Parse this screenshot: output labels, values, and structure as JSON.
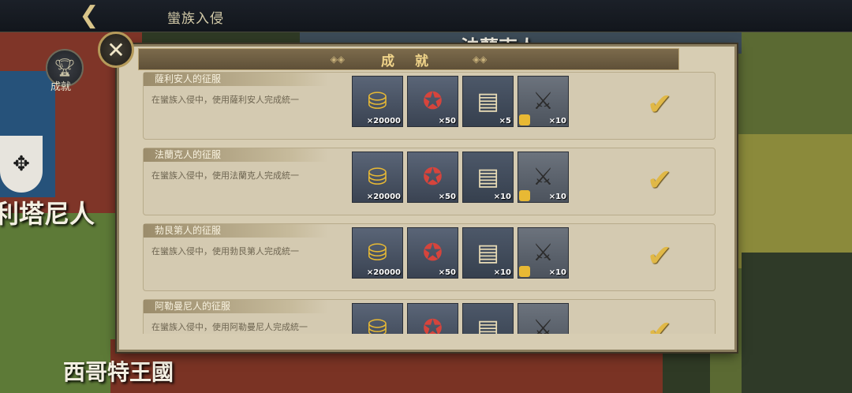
{
  "header": {
    "title": "蠻族入侵",
    "back_icon": "back-arrow-icon"
  },
  "sidebar": {
    "achievements_label": "成就"
  },
  "map": {
    "labels": [
      "利塔尼人",
      "西哥特王國",
      "法蘭克人"
    ]
  },
  "panel": {
    "title": "成 就",
    "close_icon": "close-icon",
    "achievements": [
      {
        "title": "薩利安人的征服",
        "description": "在蠻族入侵中，使用薩利安人完成統一",
        "completed": true,
        "rewards": [
          {
            "icon": "gold-coins-icon",
            "count": "×20000"
          },
          {
            "icon": "medal-icon",
            "count": "×50"
          },
          {
            "icon": "scroll-icon",
            "count": "×5"
          },
          {
            "icon": "unit-fragment-icon",
            "count": "×10"
          }
        ]
      },
      {
        "title": "法蘭克人的征服",
        "description": "在蠻族入侵中，使用法蘭克人完成統一",
        "completed": true,
        "rewards": [
          {
            "icon": "gold-coins-icon",
            "count": "×20000"
          },
          {
            "icon": "medal-icon",
            "count": "×50"
          },
          {
            "icon": "scroll-icon",
            "count": "×10"
          },
          {
            "icon": "unit-fragment-icon",
            "count": "×10"
          }
        ]
      },
      {
        "title": "勃艮第人的征服",
        "description": "在蠻族入侵中，使用勃艮第人完成統一",
        "completed": true,
        "rewards": [
          {
            "icon": "gold-coins-icon",
            "count": "×20000"
          },
          {
            "icon": "medal-icon",
            "count": "×50"
          },
          {
            "icon": "scroll-icon",
            "count": "×10"
          },
          {
            "icon": "unit-fragment-icon",
            "count": "×10"
          }
        ]
      },
      {
        "title": "阿勒曼尼人的征服",
        "description": "在蠻族入侵中，使用阿勒曼尼人完成統一",
        "completed": true,
        "rewards": [
          {
            "icon": "gold-coins-icon",
            "count": ""
          },
          {
            "icon": "medal-icon",
            "count": ""
          },
          {
            "icon": "scroll-icon",
            "count": ""
          },
          {
            "icon": "unit-fragment-icon",
            "count": ""
          }
        ]
      }
    ]
  }
}
